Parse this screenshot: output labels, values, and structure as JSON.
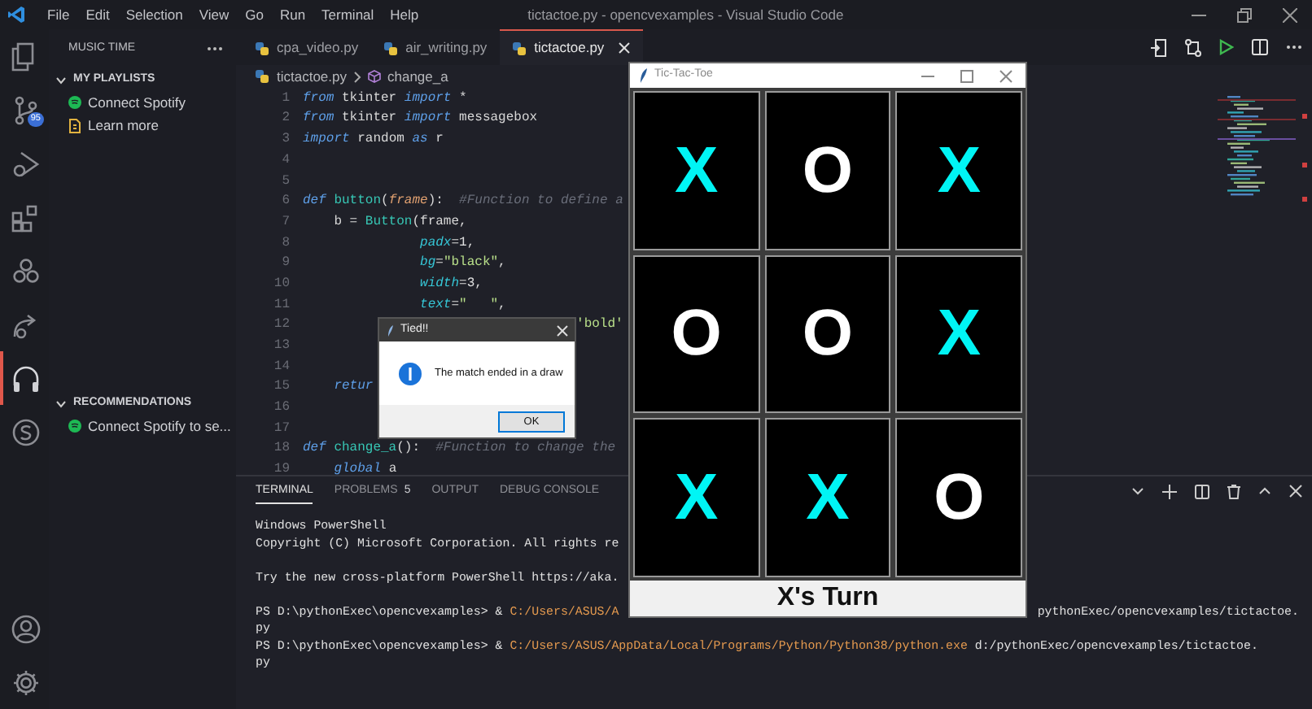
{
  "title_bar": {
    "menu": [
      "File",
      "Edit",
      "Selection",
      "View",
      "Go",
      "Run",
      "Terminal",
      "Help"
    ],
    "title": "tictactoe.py - opencvexamples - Visual Studio Code"
  },
  "activity_bar": {
    "items": [
      {
        "selected": false
      },
      {
        "selected": false,
        "badge": "95"
      },
      {
        "selected": false
      },
      {
        "selected": false
      },
      {
        "selected": false
      },
      {
        "selected": false
      },
      {
        "selected": true
      },
      {
        "selected": false
      }
    ]
  },
  "sidebar": {
    "title": "MUSIC TIME",
    "sections": [
      {
        "label": "MY PLAYLISTS",
        "expanded": true,
        "items": [
          {
            "kind": "spotify",
            "label": "Connect Spotify"
          },
          {
            "kind": "doc",
            "label": "Learn more"
          }
        ]
      },
      {
        "label": "RECOMMENDATIONS",
        "expanded": true,
        "items": [
          {
            "kind": "spotify",
            "label": "Connect Spotify to se..."
          }
        ]
      }
    ]
  },
  "editor": {
    "tabs": [
      {
        "label": "cpa_video.py",
        "selected": false
      },
      {
        "label": "air_writing.py",
        "selected": false
      },
      {
        "label": "tictactoe.py",
        "selected": true
      }
    ],
    "breadcrumbs": [
      "tictactoe.py",
      "change_a"
    ],
    "lines": [
      {
        "number": "1",
        "tokens": [
          {
            "kind": "kw",
            "text": "from"
          },
          {
            "kind": "pl",
            "text": " tkinter "
          },
          {
            "kind": "kw",
            "text": "import"
          },
          {
            "kind": "pl",
            "text": " *"
          }
        ]
      },
      {
        "number": "2",
        "tokens": [
          {
            "kind": "kw",
            "text": "from"
          },
          {
            "kind": "pl",
            "text": " tkinter "
          },
          {
            "kind": "kw",
            "text": "import"
          },
          {
            "kind": "pl",
            "text": " messagebox"
          }
        ]
      },
      {
        "number": "3",
        "tokens": [
          {
            "kind": "kw",
            "text": "import"
          },
          {
            "kind": "pl",
            "text": " random "
          },
          {
            "kind": "kw",
            "text": "as"
          },
          {
            "kind": "pl",
            "text": " r"
          }
        ]
      },
      {
        "number": "4"
      },
      {
        "number": "5"
      },
      {
        "number": "6",
        "tokens": [
          {
            "kind": "kw",
            "text": "def "
          },
          {
            "kind": "fn",
            "text": "button"
          },
          {
            "kind": "pl",
            "text": "("
          },
          {
            "kind": "par",
            "text": "frame"
          },
          {
            "kind": "pl",
            "text": "):  "
          },
          {
            "kind": "cm",
            "text": "#Function to define a"
          }
        ]
      },
      {
        "number": "7",
        "tokens": [
          {
            "kind": "pl",
            "text": "    b = "
          },
          {
            "kind": "fn",
            "text": "Button"
          },
          {
            "kind": "pl",
            "text": "(frame,"
          }
        ]
      },
      {
        "number": "8",
        "tokens": [
          {
            "kind": "arg",
            "text": "               padx"
          },
          {
            "kind": "pl",
            "text": "="
          },
          {
            "kind": "num",
            "text": "1"
          },
          {
            "kind": "pl",
            "text": ","
          }
        ]
      },
      {
        "number": "9",
        "tokens": [
          {
            "kind": "arg",
            "text": "               bg"
          },
          {
            "kind": "pl",
            "text": "="
          },
          {
            "kind": "str",
            "text": "\"black\""
          },
          {
            "kind": "pl",
            "text": ","
          }
        ]
      },
      {
        "number": "10",
        "tokens": [
          {
            "kind": "arg",
            "text": "               width"
          },
          {
            "kind": "pl",
            "text": "="
          },
          {
            "kind": "num",
            "text": "3"
          },
          {
            "kind": "pl",
            "text": ","
          }
        ]
      },
      {
        "number": "11",
        "tokens": [
          {
            "kind": "arg",
            "text": "               text"
          },
          {
            "kind": "pl",
            "text": "="
          },
          {
            "kind": "str",
            "text": "\"   \""
          },
          {
            "kind": "pl",
            "text": ","
          }
        ]
      },
      {
        "number": "12",
        "tokens": [
          {
            "kind": "str",
            "text": "                                   'bold'"
          }
        ]
      },
      {
        "number": "13"
      },
      {
        "number": "14"
      },
      {
        "number": "15",
        "tokens": [
          {
            "kind": "kw",
            "text": "    retur"
          }
        ]
      },
      {
        "number": "16"
      },
      {
        "number": "17"
      },
      {
        "number": "18",
        "tokens": [
          {
            "kind": "kw",
            "text": "def "
          },
          {
            "kind": "fn",
            "text": "change_a"
          },
          {
            "kind": "pl",
            "text": "():  "
          },
          {
            "kind": "cm",
            "text": "#Function to change the"
          }
        ]
      },
      {
        "number": "19",
        "tokens": [
          {
            "kind": "kw",
            "text": "    global"
          },
          {
            "kind": "pl",
            "text": " a"
          }
        ]
      }
    ]
  },
  "panel": {
    "tabs": [
      {
        "label": "TERMINAL",
        "selected": true
      },
      {
        "label": "PROBLEMS",
        "selected": false,
        "badge": "5"
      },
      {
        "label": "OUTPUT",
        "selected": false
      },
      {
        "label": "DEBUG CONSOLE",
        "selected": false
      }
    ],
    "terminal": [
      {
        "space_before": false,
        "segments": [
          {
            "kind": "plain",
            "text": "Windows PowerShell"
          }
        ]
      },
      {
        "space_before": false,
        "segments": [
          {
            "kind": "plain",
            "text": "Copyright (C) Microsoft Corporation. All rights re"
          }
        ]
      },
      {
        "space_before": true,
        "segments": [
          {
            "kind": "plain",
            "text": "Try the new cross-platform PowerShell https://aka."
          }
        ]
      },
      {
        "space_before": true,
        "segments": [
          {
            "kind": "plain",
            "text": "PS D:\\pythonExec\\opencvexamples> & "
          },
          {
            "kind": "path",
            "text": "C:/Users/ASUS/A"
          },
          {
            "kind": "plain",
            "text": "pythonExec/opencvexamples/tictactoe.",
            "covered_before": true
          }
        ]
      },
      {
        "space_before": false,
        "segments": [
          {
            "kind": "plain",
            "text": "py"
          }
        ]
      },
      {
        "space_before": false,
        "segments": [
          {
            "kind": "plain",
            "text": "PS D:\\pythonExec\\opencvexamples> & "
          },
          {
            "kind": "path",
            "text": "C:/Users/ASUS/AppData/Local/Programs/Python/Python38/python.exe"
          },
          {
            "kind": "plain",
            "text": " d:/pythonExec/opencvexamples/tictactoe."
          }
        ]
      },
      {
        "space_before": false,
        "segments": [
          {
            "kind": "plain",
            "text": "py"
          }
        ]
      }
    ]
  },
  "game_window": {
    "title": "Tic-Tac-Toe",
    "cells": [
      {
        "kind": "x",
        "text": "X"
      },
      {
        "kind": "o",
        "text": "O"
      },
      {
        "kind": "x",
        "text": "X"
      },
      {
        "kind": "o",
        "text": "O"
      },
      {
        "kind": "o",
        "text": "O"
      },
      {
        "kind": "x",
        "text": "X"
      },
      {
        "kind": "x",
        "text": "X"
      },
      {
        "kind": "x",
        "text": "X"
      },
      {
        "kind": "o",
        "text": "O"
      }
    ],
    "status": "X's Turn"
  },
  "dialog": {
    "title": "Tied!!",
    "message": "The match ended in a draw",
    "button": "OK"
  }
}
